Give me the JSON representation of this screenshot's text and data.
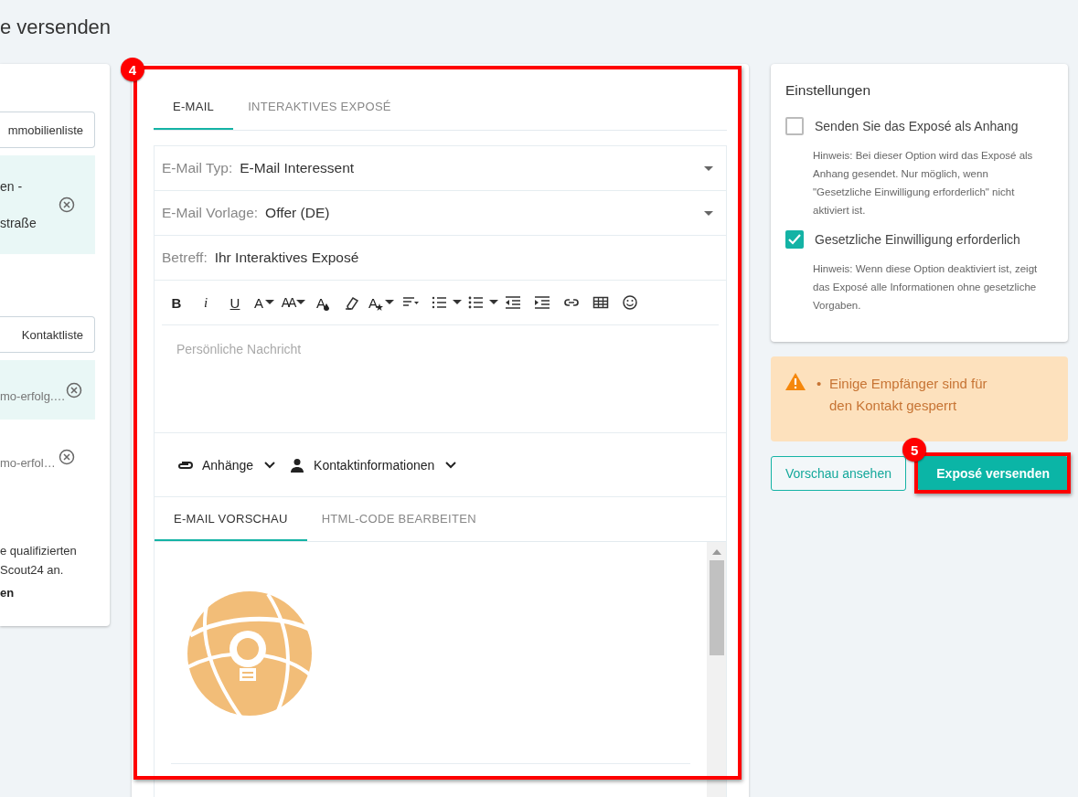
{
  "page_title": "e versenden",
  "left_panel": {
    "property_button": "mmobilienliste",
    "property_item": {
      "lines": [
        "en -",
        "straße"
      ]
    },
    "contact_button": "Kontaktliste",
    "contacts": [
      {
        "email": "mo-erfolg.…",
        "highlighted": true
      },
      {
        "email": "mo-erfol…",
        "highlighted": false
      }
    ],
    "note_lines": [
      "e qualifizierten",
      "Scout24 an."
    ],
    "link": "en"
  },
  "tabs": [
    {
      "label": "E-MAIL",
      "selected": true
    },
    {
      "label": "INTERAKTIVES EXPOSÉ",
      "selected": false
    }
  ],
  "fields": [
    {
      "kind": "select",
      "label": "E-Mail Typ:",
      "value": "E-Mail Interessent"
    },
    {
      "kind": "select",
      "label": "E-Mail Vorlage:",
      "value": "Offer (DE)"
    },
    {
      "kind": "text",
      "label": "Betreff:",
      "value": "Ihr Interaktives Exposé"
    }
  ],
  "toolbar": [
    {
      "kind": "bold",
      "glyph": "B"
    },
    {
      "kind": "italic",
      "glyph": "i"
    },
    {
      "kind": "underline",
      "glyph": "U"
    },
    {
      "kind": "font",
      "glyph": "A"
    },
    {
      "kind": "font-size",
      "glyph": "AA"
    },
    {
      "kind": "color",
      "glyph": "A"
    },
    {
      "kind": "eraser"
    },
    {
      "kind": "style",
      "glyph": "A"
    },
    {
      "kind": "align"
    },
    {
      "kind": "ordered-list"
    },
    {
      "kind": "caret"
    },
    {
      "kind": "bullet-list"
    },
    {
      "kind": "caret"
    },
    {
      "kind": "outdent"
    },
    {
      "kind": "indent"
    },
    {
      "kind": "link"
    },
    {
      "kind": "table"
    },
    {
      "kind": "emoji"
    }
  ],
  "message_placeholder": "Persönliche Nachricht",
  "menus": [
    {
      "kind": "attachments",
      "label": "Anhänge"
    },
    {
      "kind": "contact",
      "label": "Kontaktinformationen"
    }
  ],
  "preview_tabs": [
    {
      "label": "E-MAIL VORSCHAU",
      "selected": true
    },
    {
      "label": "HTML-CODE BEARBEITEN",
      "selected": false
    }
  ],
  "settings": {
    "title": "Einstellungen",
    "options": [
      {
        "label": "Senden Sie das Exposé als Anhang",
        "checked": false,
        "hint": "Hinweis: Bei dieser Option wird das Exposé als Anhang gesendet. Nur möglich, wenn \"Gesetzliche Einwilligung erforderlich\" nicht aktiviert ist."
      },
      {
        "label": "Gesetzliche Einwilligung erforderlich",
        "checked": true,
        "hint": "Hinweis: Wenn diese Option deaktiviert ist, zeigt das Exposé alle Informationen ohne gesetzliche Vorgaben."
      }
    ]
  },
  "warning": {
    "items": [
      {
        "bullet": "•",
        "text": "Einige Empfänger sind für den Kontakt gesperrt"
      }
    ]
  },
  "buttons": [
    {
      "kind": "secondary",
      "label": "Vorschau ansehen"
    },
    {
      "kind": "primary",
      "label": "Exposé versenden"
    }
  ],
  "annotations": [
    {
      "label": "4"
    },
    {
      "label": "5"
    }
  ]
}
